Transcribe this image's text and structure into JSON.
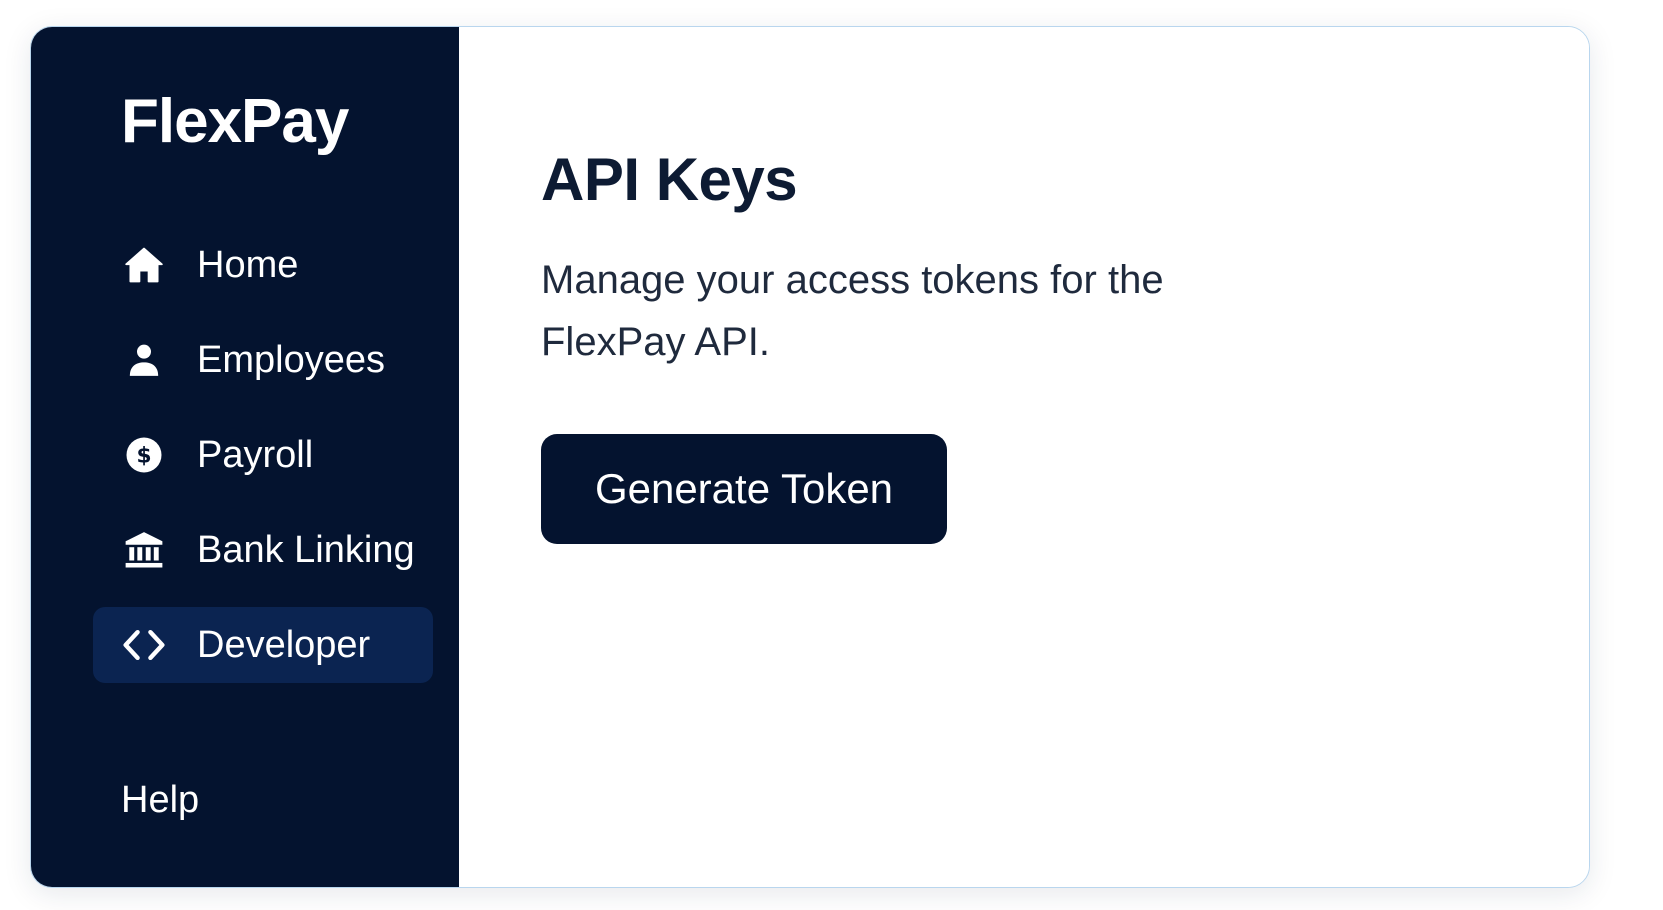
{
  "brand": {
    "name": "FlexPay"
  },
  "sidebar": {
    "items": [
      {
        "label": "Home",
        "icon": "home-icon",
        "active": false
      },
      {
        "label": "Employees",
        "icon": "user-icon",
        "active": false
      },
      {
        "label": "Payroll",
        "icon": "dollar-circle-icon",
        "active": false
      },
      {
        "label": "Bank Linking",
        "icon": "bank-icon",
        "active": false
      },
      {
        "label": "Developer",
        "icon": "code-icon",
        "active": true
      }
    ],
    "help_label": "Help"
  },
  "main": {
    "title": "API Keys",
    "subtitle": "Manage your access tokens for the FlexPay API.",
    "generate_button_label": "Generate Token"
  },
  "colors": {
    "sidebar_bg": "#04132f",
    "active_item_bg": "#0b2451",
    "primary_button": "#04132f",
    "text_dark": "#0d1b33",
    "window_border": "#b9d6ee"
  }
}
